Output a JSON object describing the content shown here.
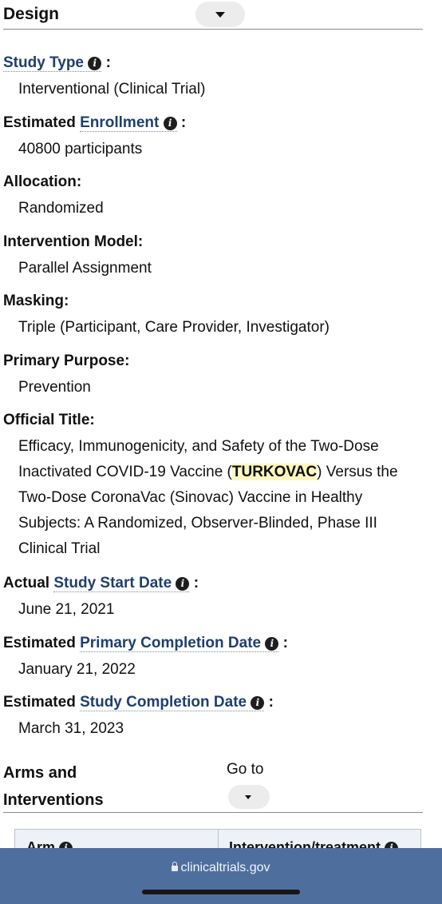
{
  "design": {
    "title": "Design",
    "study_type": {
      "label": "Study Type",
      "suffix": ":",
      "value": "Interventional  (Clinical Trial)"
    },
    "enrollment": {
      "prefix": "Estimated ",
      "label": "Enrollment",
      "suffix": ":",
      "value": "40800 participants"
    },
    "allocation": {
      "label": "Allocation:",
      "value": "Randomized"
    },
    "intervention_model": {
      "label": "Intervention Model:",
      "value": "Parallel Assignment"
    },
    "masking": {
      "label": "Masking:",
      "value": "Triple (Participant, Care Provider, Investigator)"
    },
    "primary_purpose": {
      "label": "Primary Purpose:",
      "value": "Prevention"
    },
    "official_title": {
      "label": "Official Title:",
      "before": "Efficacy, Immunogenicity, and Safety of the Two-Dose Inactivated COVID-19 Vaccine (",
      "highlight": "TURKOVAC",
      "after": ") Versus the Two-Dose CoronaVac (Sinovac) Vaccine in Healthy Subjects: A Randomized, Observer-Blinded, Phase III Clinical Trial"
    },
    "start_date": {
      "prefix": "Actual ",
      "label": "Study Start Date",
      "suffix": ":",
      "value": "June 21, 2021"
    },
    "primary_completion": {
      "prefix": "Estimated ",
      "label": "Primary Completion Date",
      "suffix": ":",
      "value": "January 21, 2022"
    },
    "study_completion": {
      "prefix": "Estimated ",
      "label": "Study Completion Date",
      "suffix": ":",
      "value": "March 31, 2023"
    }
  },
  "arms": {
    "title_line1": "Arms and",
    "title_line2": "Interventions",
    "goto_label": "Go to",
    "table_headers": [
      "Arm",
      "Intervention/treatment"
    ]
  },
  "browser": {
    "url": "clinicaltrials.gov"
  },
  "icons": {
    "info": "info-icon",
    "dropdown": "caret-down-icon",
    "lock": "lock-icon"
  },
  "colors": {
    "link": "#1f3f6e",
    "highlight": "#fff7bf",
    "bottom_bar": "#4e6f9e"
  }
}
